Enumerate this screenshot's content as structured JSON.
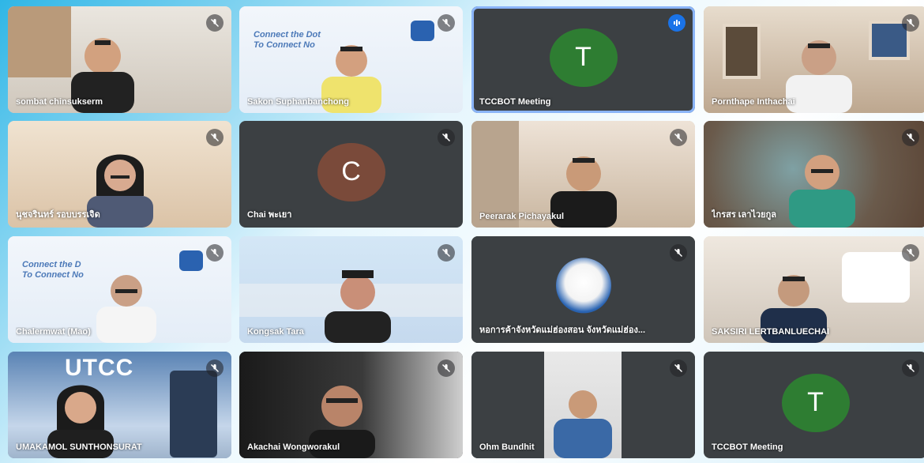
{
  "participants": [
    {
      "name": "sombat chinsukserm",
      "avatar_letter": "",
      "avatar_color": "",
      "status": "muted"
    },
    {
      "name": "Sakon Suphanbanchong",
      "avatar_letter": "",
      "avatar_color": "",
      "status": "muted",
      "banner_line1": "Connect the Dot",
      "banner_line2": "To Connect No"
    },
    {
      "name": "TCCBOT Meeting",
      "avatar_letter": "T",
      "avatar_color": "#2e7d32",
      "status": "speaking"
    },
    {
      "name": "Pornthape Inthachai",
      "avatar_letter": "",
      "avatar_color": "",
      "status": "muted"
    },
    {
      "name": "นุชจรินทร์ รอบบรรเจิด",
      "avatar_letter": "",
      "avatar_color": "",
      "status": "muted"
    },
    {
      "name": "Chai พะเยา",
      "avatar_letter": "C",
      "avatar_color": "#7a4a3a",
      "status": "muted"
    },
    {
      "name": "Peerarak Pichayakul",
      "avatar_letter": "",
      "avatar_color": "",
      "status": "muted"
    },
    {
      "name": "ไกรสร เลาไวยกูล",
      "avatar_letter": "",
      "avatar_color": "",
      "status": "muted"
    },
    {
      "name": "Chalermwat (Mao)",
      "avatar_letter": "",
      "avatar_color": "",
      "status": "muted",
      "banner_line1": "Connect the D",
      "banner_line2": "To Connect No"
    },
    {
      "name": "Kongsak Tara",
      "avatar_letter": "",
      "avatar_color": "",
      "status": "muted"
    },
    {
      "name": "หอการค้าจังหวัดแม่ฮ่องสอน จังหวัดแม่ฮ่อง...",
      "avatar_letter": "",
      "avatar_color": "",
      "status": "muted"
    },
    {
      "name": "SAKSIRI LERTBANLUECHAI",
      "avatar_letter": "",
      "avatar_color": "",
      "status": "muted"
    },
    {
      "name": "UMAKAMOL SUNTHONSURAT",
      "avatar_letter": "",
      "avatar_color": "",
      "status": "muted",
      "banner_line1": "UTCC"
    },
    {
      "name": "Akachai Wongworakul",
      "avatar_letter": "",
      "avatar_color": "",
      "status": "muted"
    },
    {
      "name": "Ohm Bundhit",
      "avatar_letter": "",
      "avatar_color": "",
      "status": "muted"
    },
    {
      "name": "TCCBOT Meeting",
      "avatar_letter": "T",
      "avatar_color": "#2e7d32",
      "status": "muted"
    }
  ],
  "colors": {
    "tile_bg": "#3c4043",
    "speaking_outline": "#8ab4f8",
    "speaking_badge": "#1a73e8"
  },
  "icons": {
    "muted": "mic-off-icon",
    "speaking": "audio-wave-icon"
  }
}
